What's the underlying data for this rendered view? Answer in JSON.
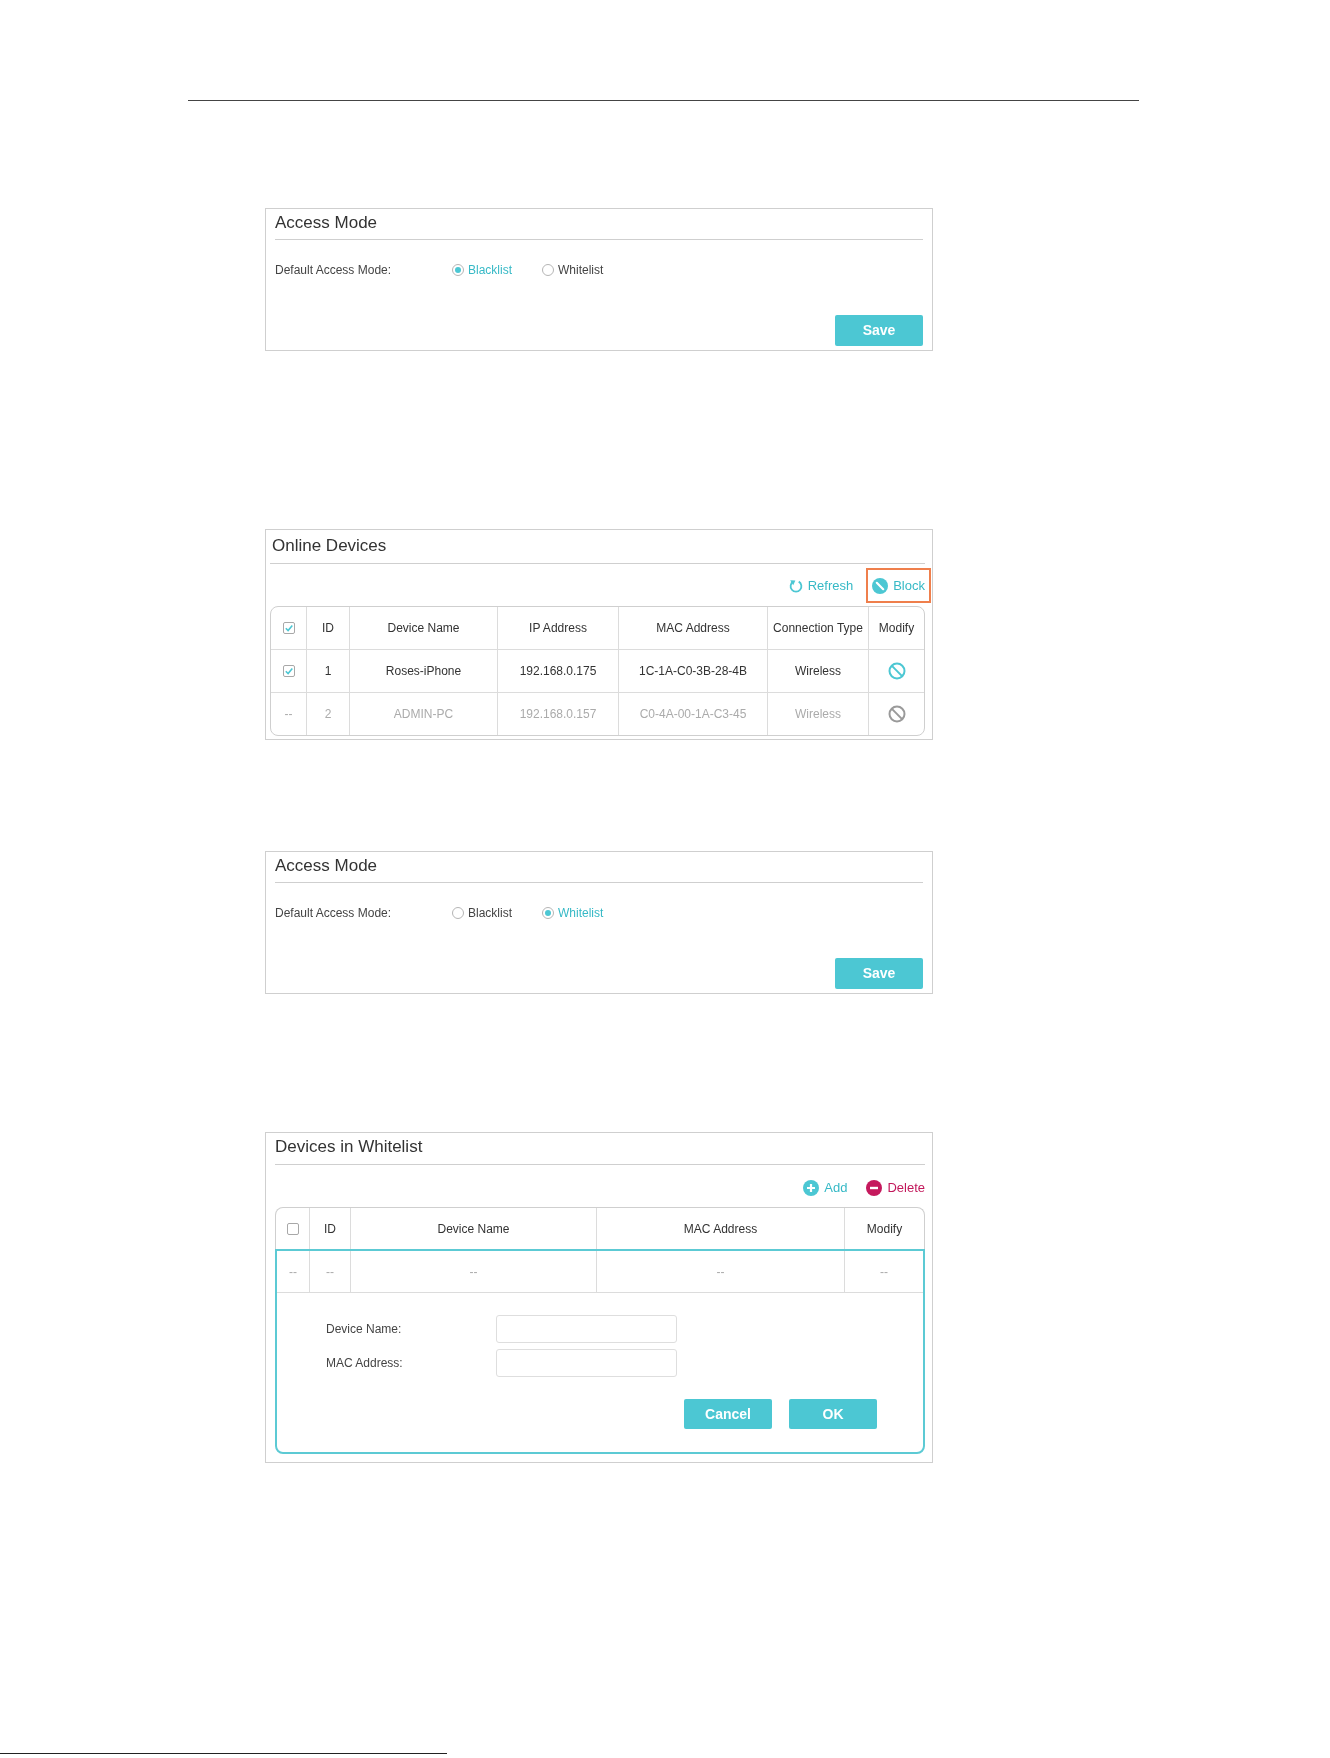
{
  "sections": [
    {
      "kind": "access_mode",
      "title": "Access Mode",
      "label": "Default Access Mode:",
      "options": [
        {
          "label": "Blacklist",
          "selected": true
        },
        {
          "label": "Whitelist",
          "selected": false
        }
      ],
      "button": "Save"
    },
    {
      "kind": "online_devices",
      "title": "Online Devices",
      "toolbar": [
        {
          "kind": "refresh",
          "label": "Refresh",
          "highlighted": false
        },
        {
          "kind": "block",
          "label": "Block",
          "highlighted": true
        }
      ],
      "table": {
        "select_all_checked": true,
        "columns": [
          "ID",
          "Device Name",
          "IP Address",
          "MAC Address",
          "Connection Type",
          "Modify"
        ],
        "rows": [
          {
            "disabled": false,
            "select": {
              "kind": "checkbox",
              "checked": true
            },
            "cells": [
              "1",
              "Roses-iPhone",
              "192.168.0.175",
              "1C-1A-C0-3B-28-4B",
              "Wireless"
            ],
            "modify": {
              "kind": "block"
            }
          },
          {
            "disabled": true,
            "select": {
              "kind": "text",
              "text": "--"
            },
            "cells": [
              "2",
              "ADMIN-PC",
              "192.168.0.157",
              "C0-4A-00-1A-C3-45",
              "Wireless"
            ],
            "modify": {
              "kind": "block"
            }
          }
        ]
      }
    },
    {
      "kind": "access_mode",
      "title": "Access Mode",
      "label": "Default Access Mode:",
      "options": [
        {
          "label": "Blacklist",
          "selected": false
        },
        {
          "label": "Whitelist",
          "selected": true
        }
      ],
      "button": "Save"
    },
    {
      "kind": "whitelist",
      "title": "Devices in Whitelist",
      "toolbar": [
        {
          "kind": "add",
          "label": "Add",
          "highlighted": false
        },
        {
          "kind": "delete",
          "label": "Delete",
          "highlighted": false
        }
      ],
      "table": {
        "select_all_checked": false,
        "columns": [
          "ID",
          "Device Name",
          "MAC Address",
          "Modify"
        ],
        "rows": [
          {
            "disabled": true,
            "select": {
              "kind": "text",
              "text": "--"
            },
            "cells": [
              "--",
              "--",
              "--"
            ],
            "modify": {
              "kind": "text",
              "text": "--"
            }
          }
        ]
      },
      "editor": {
        "fields": [
          {
            "label": "Device Name:"
          },
          {
            "label": "MAC Address:"
          }
        ],
        "buttons": [
          "Cancel",
          "OK"
        ]
      }
    }
  ]
}
